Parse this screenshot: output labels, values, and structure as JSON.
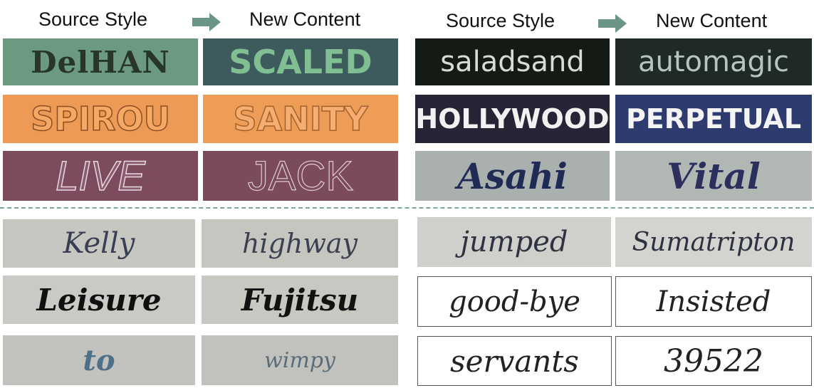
{
  "headers": {
    "left_source": "Source Style",
    "left_new": "New Content",
    "right_source": "Source Style",
    "right_new": "New Content"
  },
  "colors": {
    "arrow": "#6a9486",
    "divider": "#7aa7a2"
  },
  "tiles": {
    "r1c1": "DelHAN",
    "r1c2": "SCALED",
    "r1c3": "saladsand",
    "r1c4": "automagic",
    "r2c1": "SPIROU",
    "r2c2": "SANITY",
    "r2c3": "HOLLYWOOD",
    "r2c4": "PERPETUAL",
    "r3c1": "LIVE",
    "r3c2": "JACK",
    "r3c3": "Asahi",
    "r3c4": "Vital",
    "r4c1": "Kelly",
    "r4c2": "highway",
    "r4c3": "jumped",
    "r4c4": "Sumatripton",
    "r5c1": "Leisure",
    "r5c2": "Fujitsu",
    "r5c3": "good-bye",
    "r5c4": "Insisted",
    "r6c1": "to",
    "r6c2": "wimpy",
    "r6c3": "servants",
    "r6c4": "39522"
  }
}
